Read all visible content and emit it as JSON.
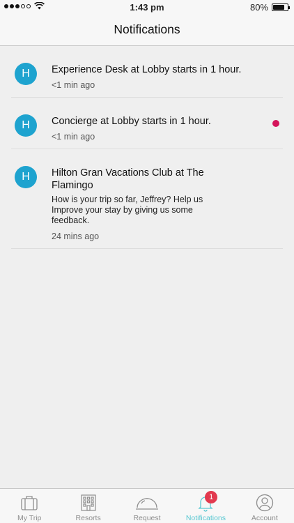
{
  "status_bar": {
    "time": "1:43 pm",
    "battery_percent": "80%",
    "battery_level": 0.8
  },
  "header": {
    "title": "Notifications"
  },
  "notifications": [
    {
      "avatar_letter": "H",
      "title": "Experience Desk at Lobby starts in 1 hour.",
      "body": "",
      "time": "<1 min ago",
      "unread": false
    },
    {
      "avatar_letter": "H",
      "title": "Concierge at Lobby starts in 1 hour.",
      "body": "",
      "time": "<1 min ago",
      "unread": true
    },
    {
      "avatar_letter": "H",
      "title_line1": "Hilton Gran Vacations Club at The",
      "title_line2": "Flamingo",
      "body_line1": "How is your trip so far, Jeffrey? Help us",
      "body_line2": "Improve your stay by giving us some",
      "body_line3": "feedback.",
      "time": "24 mins ago",
      "unread": false
    }
  ],
  "tab_bar": {
    "tabs": [
      {
        "label": "My Trip",
        "icon": "suitcase-icon"
      },
      {
        "label": "Resorts",
        "icon": "building-icon"
      },
      {
        "label": "Request",
        "icon": "service-bell-icon"
      },
      {
        "label": "Notifications",
        "icon": "bell-icon",
        "badge": "1",
        "active": true
      },
      {
        "label": "Account",
        "icon": "person-icon"
      }
    ]
  },
  "colors": {
    "accent": "#5ac8d2",
    "avatar": "#1ea3cf",
    "unread_dot": "#d4145a",
    "badge": "#e23a4f"
  }
}
